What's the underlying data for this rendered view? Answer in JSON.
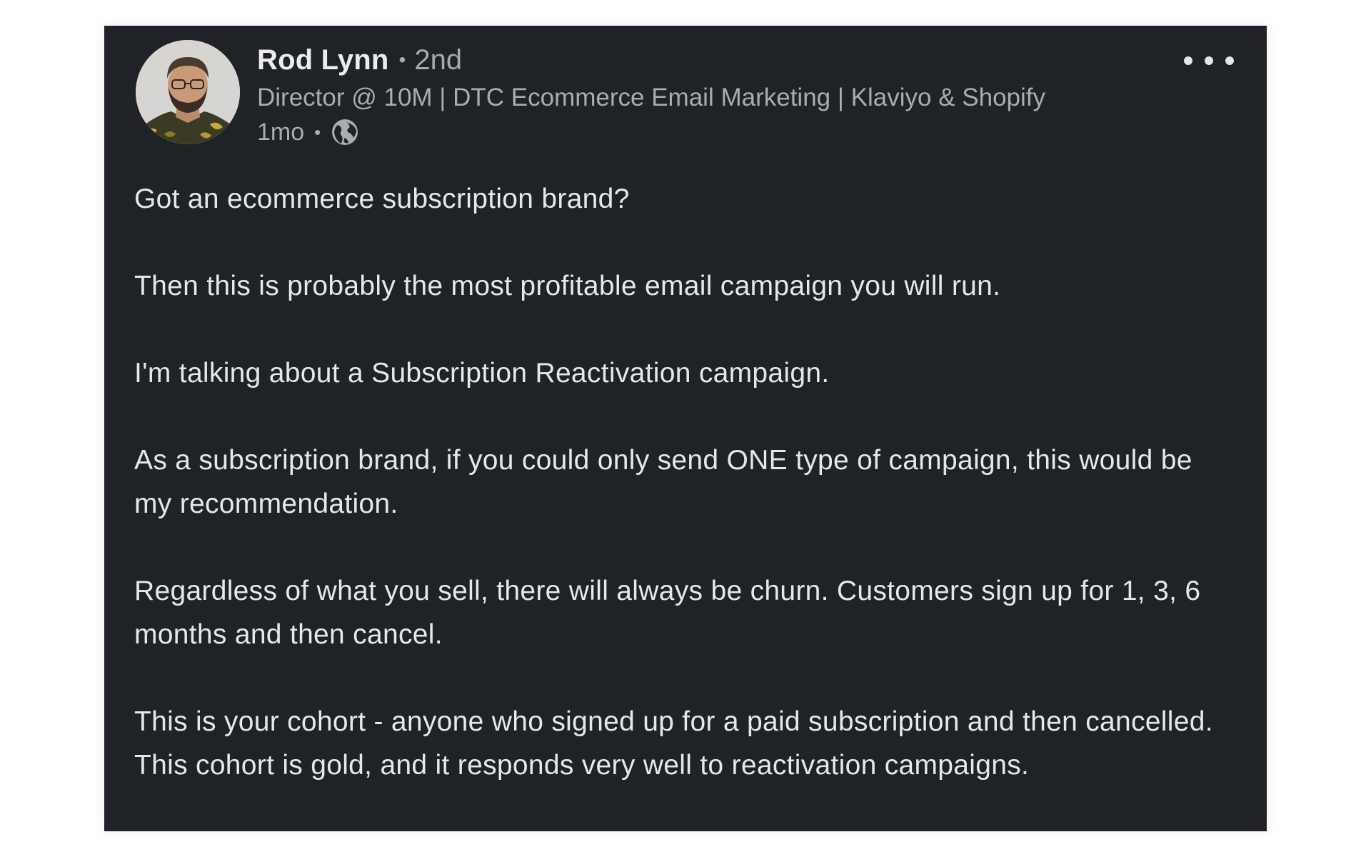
{
  "post": {
    "author": {
      "name": "Rod Lynn",
      "separator": "•",
      "connection_degree": "2nd",
      "headline": "Director @ 10M | DTC Ecommerce Email Marketing | Klaviyo & Shopify",
      "avatar_icon": "profile-photo"
    },
    "meta": {
      "age": "1mo",
      "separator": "•",
      "visibility_icon": "globe-icon"
    },
    "more_icon": "ellipsis-icon",
    "paragraphs": [
      "Got an ecommerce subscription brand?",
      "Then this is probably the most profitable email campaign you will run.",
      "I'm talking about a Subscription Reactivation campaign.",
      "As a subscription brand, if you could only send ONE type of campaign, this would be my recommendation.",
      "Regardless of what you sell, there will always be churn. Customers sign up for 1, 3, 6 months and then cancel.",
      "This is your cohort - anyone who signed up for a paid subscription and then cancelled. This cohort is gold, and it responds very well to reactivation campaigns."
    ],
    "colors": {
      "card_background": "#1f2226",
      "text_primary": "#e6e7e8",
      "text_secondary": "#a9acb0"
    }
  }
}
